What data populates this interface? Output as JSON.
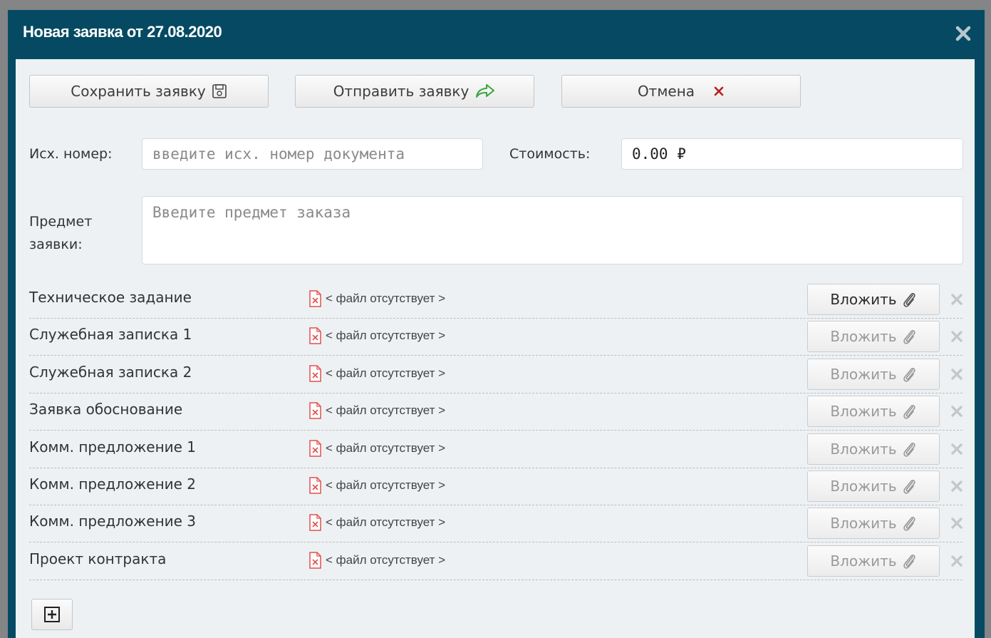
{
  "dialog": {
    "title": "Новая заявка от 27.08.2020"
  },
  "toolbar": {
    "save_label": "Сохранить заявку",
    "send_label": "Отправить заявку",
    "cancel_label": "Отмена"
  },
  "form": {
    "out_number_label": "Исх. номер:",
    "out_number_placeholder": "введите исх. номер документа",
    "cost_label": "Стоимость:",
    "cost_value": "0.00 ₽",
    "subject_label_line1": "Предмет",
    "subject_label_line2": "заявки:",
    "subject_placeholder": "Введите предмет заказа"
  },
  "attachments": {
    "attach_label": "Вложить",
    "no_file_text": "< файл отсутствует >",
    "rows": [
      {
        "label": "Техническое задание"
      },
      {
        "label": "Служебная записка 1"
      },
      {
        "label": "Служебная записка 2"
      },
      {
        "label": "Заявка обоснование"
      },
      {
        "label": "Комм. предложение 1"
      },
      {
        "label": "Комм. предложение 2"
      },
      {
        "label": "Комм. предложение 3"
      },
      {
        "label": "Проект контракта"
      }
    ]
  },
  "colors": {
    "titlebar": "#054a62",
    "panel": "#edf1f3",
    "cancel_icon": "#b52020",
    "send_icon": "#3aa540",
    "no_file_icon": "#e0504e"
  },
  "icons": {
    "save": "floppy-disk-icon",
    "send": "share-arrow-icon",
    "cancel": "x-mark-icon",
    "close": "close-icon",
    "no_file": "missing-file-icon",
    "attach": "paperclip-icon",
    "delete": "delete-x-icon",
    "add": "plus-box-icon"
  }
}
